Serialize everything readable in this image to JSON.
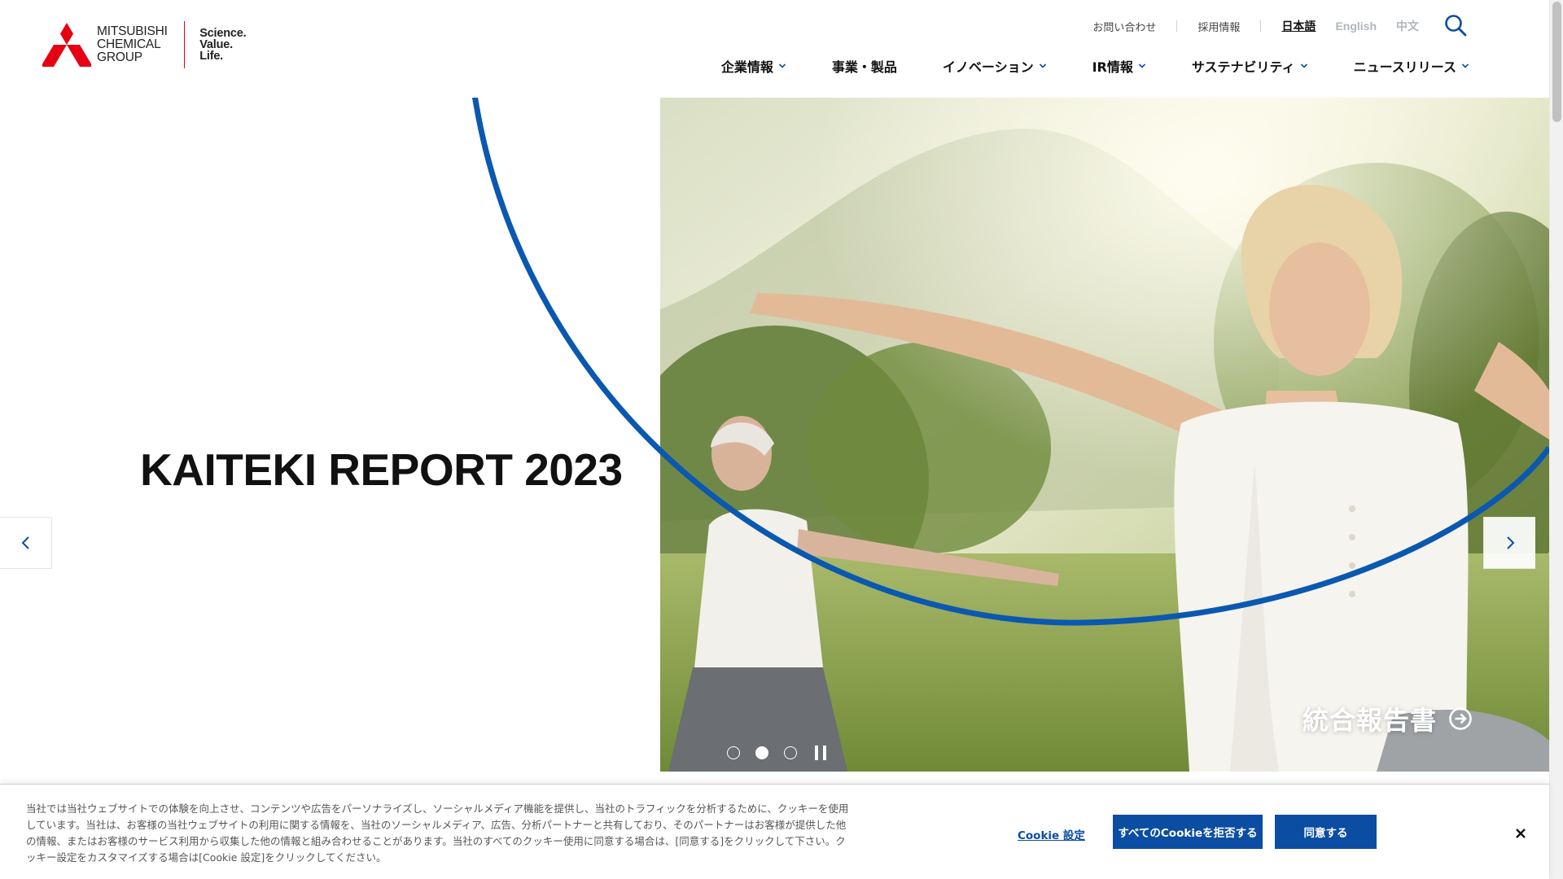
{
  "brand": {
    "logo_lines": [
      "MITSUBISHI",
      "CHEMICAL",
      "GROUP"
    ],
    "tagline_lines": [
      "Science.",
      "Value.",
      "Life."
    ],
    "colors": {
      "red": "#e60012",
      "blue": "#0b4da2",
      "arc_blue": "#0a58b0"
    }
  },
  "utility": {
    "contact": "お問い合わせ",
    "careers": "採用情報",
    "lang_ja": "日本語",
    "lang_en": "English",
    "lang_zh": "中文",
    "search_icon": "search-icon"
  },
  "nav": {
    "items": [
      {
        "label": "企業情報",
        "has_dropdown": true
      },
      {
        "label": "事業・製品",
        "has_dropdown": false
      },
      {
        "label": "イノベーション",
        "has_dropdown": true
      },
      {
        "label": "IR情報",
        "has_dropdown": true
      },
      {
        "label": "サステナビリティ",
        "has_dropdown": true
      },
      {
        "label": "ニュースリリース",
        "has_dropdown": true
      }
    ]
  },
  "hero": {
    "title": "KAITEKI REPORT 2023",
    "cta_label": "統合報告書",
    "slides_total": 3,
    "active_slide": 2
  },
  "cookie": {
    "text": "当社では当社ウェブサイトでの体験を向上させ、コンテンツや広告をパーソナライズし、ソーシャルメディア機能を提供し、当社のトラフィックを分析するために、クッキーを使用しています。当社は、お客様の当社ウェブサイトの利用に関する情報を、当社のソーシャルメディア、広告、分析パートナーと共有しており、そのパートナーはお客様が提供した他の情報、またはお客様のサービス利用から収集した他の情報と組み合わせることがあります。当社のすべてのクッキー使用に同意する場合は、[同意する]をクリックして下さい。クッキー設定をカスタマイズする場合は[Cookie 設定]をクリックしてください。",
    "settings_label": "Cookie 設定",
    "reject_label": "すべてのCookieを拒否する",
    "accept_label": "同意する"
  }
}
